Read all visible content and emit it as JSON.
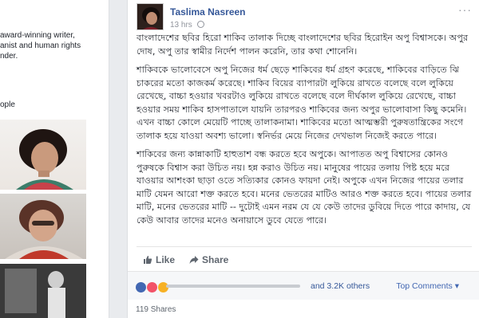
{
  "sidebar": {
    "bio_lines": [
      "award-winning writer,",
      "anist and human rights",
      "nder."
    ],
    "people_label": "ople"
  },
  "post": {
    "author": "Taslima Nasreen",
    "time": "13 hrs",
    "more": "···",
    "paragraphs": [
      "বাংলাদেশের ছবির হিরো শাকিব তালাক দিচ্ছে বাংলাদেশের ছবির হিরোইন অপু বিশ্বাসকে। অপুর দোষ, অপু তার স্বামীর নির্দেশ পালন করেনি, তার কথা শোনেনি।",
      "শাকিবকে ভালোবেসে অপু নিজের ধর্ম ছেড়ে শাকিবের ধর্ম গ্রহণ করেছে, শাকিবের বাড়িতে ঝি চাকরের মতো কাজকর্ম করেছে। শাকিব বিয়ের ব্যাপারটা লুকিয়ে রাখতে বলেছে বলে লুকিয়ে রেখেছে, বাচ্চা হওয়ার খবরটাও লুকিয়ে রাখতে বলেছে বলে দীর্ঘকাল লুকিয়ে রেখেছে, বাচ্চা হওয়ার সময় শাকিব হাসপাতালে যায়নি তারপরও শাকিবের জন্য অপুর ভালোবাসা কিছু কমেনি। এখন বাচ্চা কোলে মেয়েটি পাচ্ছে তালাকনামা। শাকিবের মতো আত্মম্ভরী পুরুষতান্ত্রিকের সংগে তালাক হয়ে যাওয়া অবশ্য ভালো। স্বনির্ভর মেয়ে নিজের দেখভাল নিজেই করতে পারে।",
      "শাকিবের জন্য কান্নাকাটি হাহুতাশ বন্ধ করতে হবে অপুকে। আপাতত অপু বিশ্বাসের কোনও পুরুষকে বিশ্বাস করা উচিত নয়। হন্ন করাও উচিত নয়। মানুষের পায়ের তলায় পিষ্ট হয়ে মরে যাওয়ার আশংকা ছাড়া ওতে সত্যিকার কোনও ফায়দা নেই। অপুকে এখন নিজের পায়ের তলার মাটি যেমন আরো শক্ত করতে হবে। মনের ভেতরের মাটিও আরও শক্ত করতে হবে। পায়ের তলার মাটি, মনের ভেতরের মাটি -- দুটোই এমন নরম যে যে কেউ তাদের ডুবিয়ে দিতে পারে কাদায়, যে কেউ আবার তাদের মনেও অনায়াসে ডুবে যেতে পারে।"
    ],
    "actions": {
      "like": "Like",
      "share": "Share"
    },
    "reactions": {
      "others": "and 3.2K others",
      "top_comments": "Top Comments ▾"
    },
    "shares": "119 Shares"
  },
  "colors": {
    "link": "#365899",
    "like_reaction": "#4267b2",
    "love_reaction": "#f25268",
    "sad_reaction": "#f7b125"
  }
}
